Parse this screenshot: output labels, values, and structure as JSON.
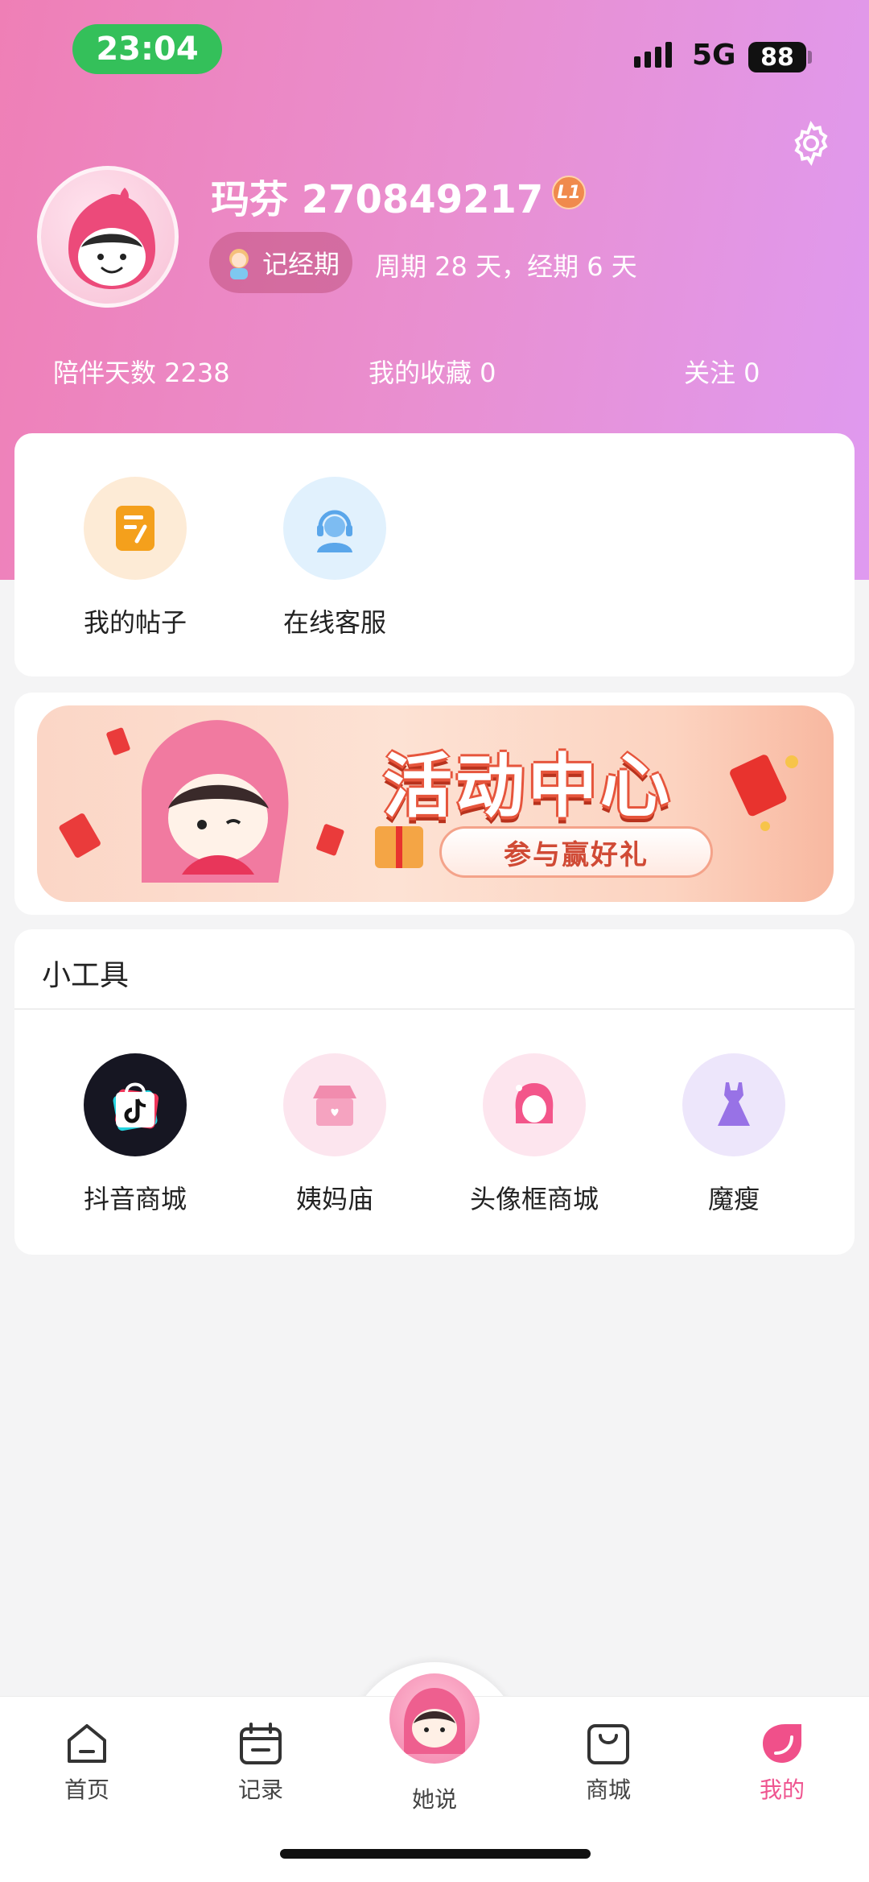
{
  "status_bar": {
    "time": "23:04",
    "network": "5G",
    "battery": "88"
  },
  "profile": {
    "username": "玛芬 270849217",
    "level": "L1",
    "period_button_label": "记经期",
    "cycle_info": "周期 28 天，经期 6 天"
  },
  "stats": {
    "companion_days": "陪伴天数 2238",
    "favorites": "我的收藏 0",
    "following": "关注 0"
  },
  "shortcuts": [
    {
      "label": "我的帖子",
      "icon": "note-edit-icon"
    },
    {
      "label": "在线客服",
      "icon": "customer-service-icon"
    }
  ],
  "banner": {
    "title": "活动中心",
    "subtitle": "参与赢好礼"
  },
  "tools": {
    "title": "小工具",
    "items": [
      {
        "label": "抖音商城",
        "icon": "douyin-mall-icon"
      },
      {
        "label": "姨妈庙",
        "icon": "temple-icon"
      },
      {
        "label": "头像框商城",
        "icon": "avatar-frame-icon"
      },
      {
        "label": "魔瘦",
        "icon": "dress-icon"
      }
    ]
  },
  "bottom_nav": [
    {
      "label": "首页",
      "icon": "home-icon",
      "active": false
    },
    {
      "label": "记录",
      "icon": "calendar-icon",
      "active": false
    },
    {
      "label": "她说",
      "icon": "mascot-avatar-icon",
      "active": false
    },
    {
      "label": "商城",
      "icon": "shopping-bag-icon",
      "active": false
    },
    {
      "label": "我的",
      "icon": "profile-icon",
      "active": true
    }
  ],
  "colors": {
    "hero_start": "#ef7fb6",
    "hero_end": "#df9af0",
    "accent": "#ef5590",
    "status_time_bg": "#34c05a"
  }
}
